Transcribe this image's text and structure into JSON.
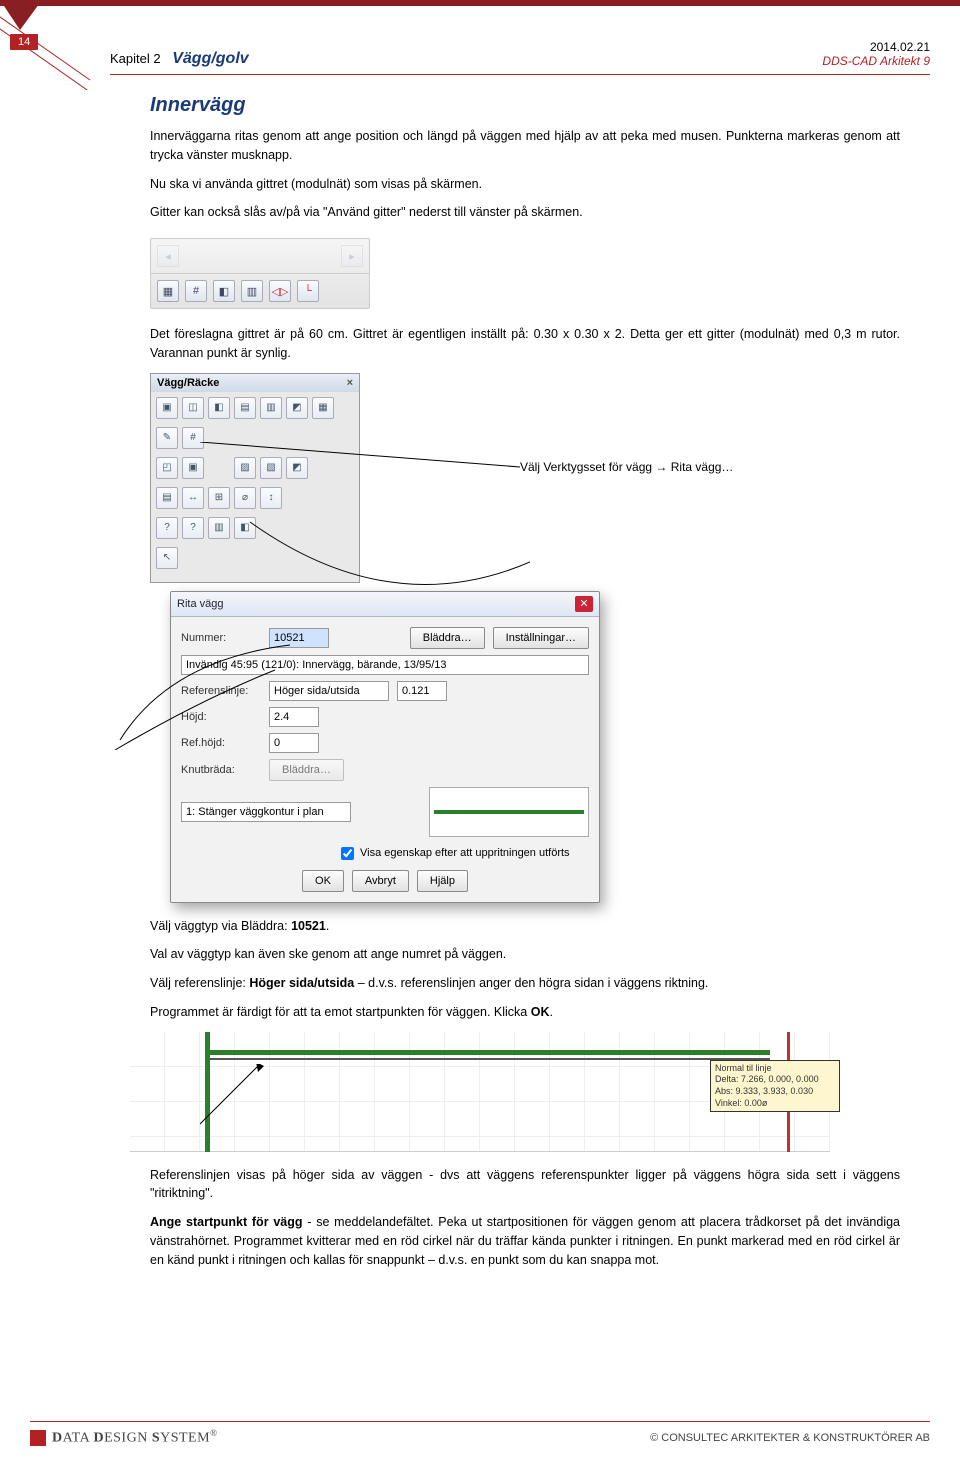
{
  "page_number": "14",
  "header": {
    "chapter": "Kapitel 2",
    "title": "Vägg/golv",
    "date": "2014.02.21",
    "app": "DDS-CAD Arkitekt 9"
  },
  "section_title": "Innervägg",
  "para1": "Innerväggarna ritas genom att ange position och längd på väggen med hjälp av att peka med musen. Punkterna markeras genom att trycka vänster musknapp.",
  "para2": "Nu ska vi använda gittret (modulnät) som visas på skärmen.",
  "para3": "Gitter kan också slås av/på via \"Använd gitter\" nederst till vänster på skärmen.",
  "para4": "Det föreslagna gittret är på 60 cm. Gittret är egentligen inställt på: 0.30 x 0.30 x 2. Detta ger ett gitter (modulnät) med 0,3 m rutor. Varannan punkt är synlig.",
  "callout1": "Välj Verktygsset för vägg → Rita vägg…",
  "panel": {
    "title": "Vägg/Räcke",
    "close": "×"
  },
  "dialog": {
    "title": "Rita vägg",
    "nummer_label": "Nummer:",
    "nummer_value": "10521",
    "bladdra": "Bläddra…",
    "installningar": "Inställningar…",
    "combo_value": "Invändig 45:95 (121/0): Innervägg, bärande, 13/95/13",
    "referenslinje_label": "Referenslinje:",
    "referenslinje_value": "Höger sida/utsida",
    "ref_num": "0.121",
    "hojd_label": "Höjd:",
    "hojd_value": "2.4",
    "refhojd_label": "Ref.höjd:",
    "refhojd_value": "0",
    "knutbrada_label": "Knutbräda:",
    "knutbrada_btn": "Bläddra…",
    "stanger": "1: Stänger väggkontur i plan",
    "check_label": "Visa egenskap efter att uppritningen utförts",
    "ok": "OK",
    "avbryt": "Avbryt",
    "hjalp": "Hjälp"
  },
  "para5_1": "Välj väggtyp via Bläddra: ",
  "para5_bold": "10521",
  "para5_2": ".",
  "para6": "Val av väggtyp kan även ske genom att ange numret på väggen.",
  "para7_1": "Välj referenslinje: ",
  "para7_bold": "Höger sida/utsida",
  "para7_2": " – d.v.s. referenslinjen anger den högra sidan i väggens riktning.",
  "para8_1": "Programmet är färdigt för att ta emot startpunkten för väggen. Klicka ",
  "para8_bold": "OK",
  "para8_2": ".",
  "infobox": {
    "l1": "Normal til linje",
    "l2": "Delta: 7.266, 0.000, 0.000",
    "l3": "Abs: 9.333, 3.933, 0.030",
    "l4": "Vinkel: 0.00ø"
  },
  "para9": "Referenslinjen visas på höger sida av väggen - dvs att väggens referenspunkter ligger på väggens högra sida sett i väggens \"ritriktning\".",
  "para10_1": "Ange startpunkt för vägg",
  "para10_2": " - se meddelandefältet. Peka ut startpositionen för väggen genom att placera trådkorset på det invändiga vänstrahörnet. Programmet kvitterar med en röd cirkel när du träffar kända punkter i ritningen. En punkt markerad med en röd cirkel är en känd punkt i ritningen och kallas för snappunkt – d.v.s. en punkt som du kan snappa mot.",
  "footer": {
    "brand_prefix": "D",
    "brand1": "ATA ",
    "brand_prefix2": "D",
    "brand2": "ESIGN ",
    "brand_prefix3": "S",
    "brand3": "YSTEM",
    "reg": "®",
    "right": "©  CONSULTEC ARKITEKTER & KONSTRUKTÖRER AB"
  }
}
